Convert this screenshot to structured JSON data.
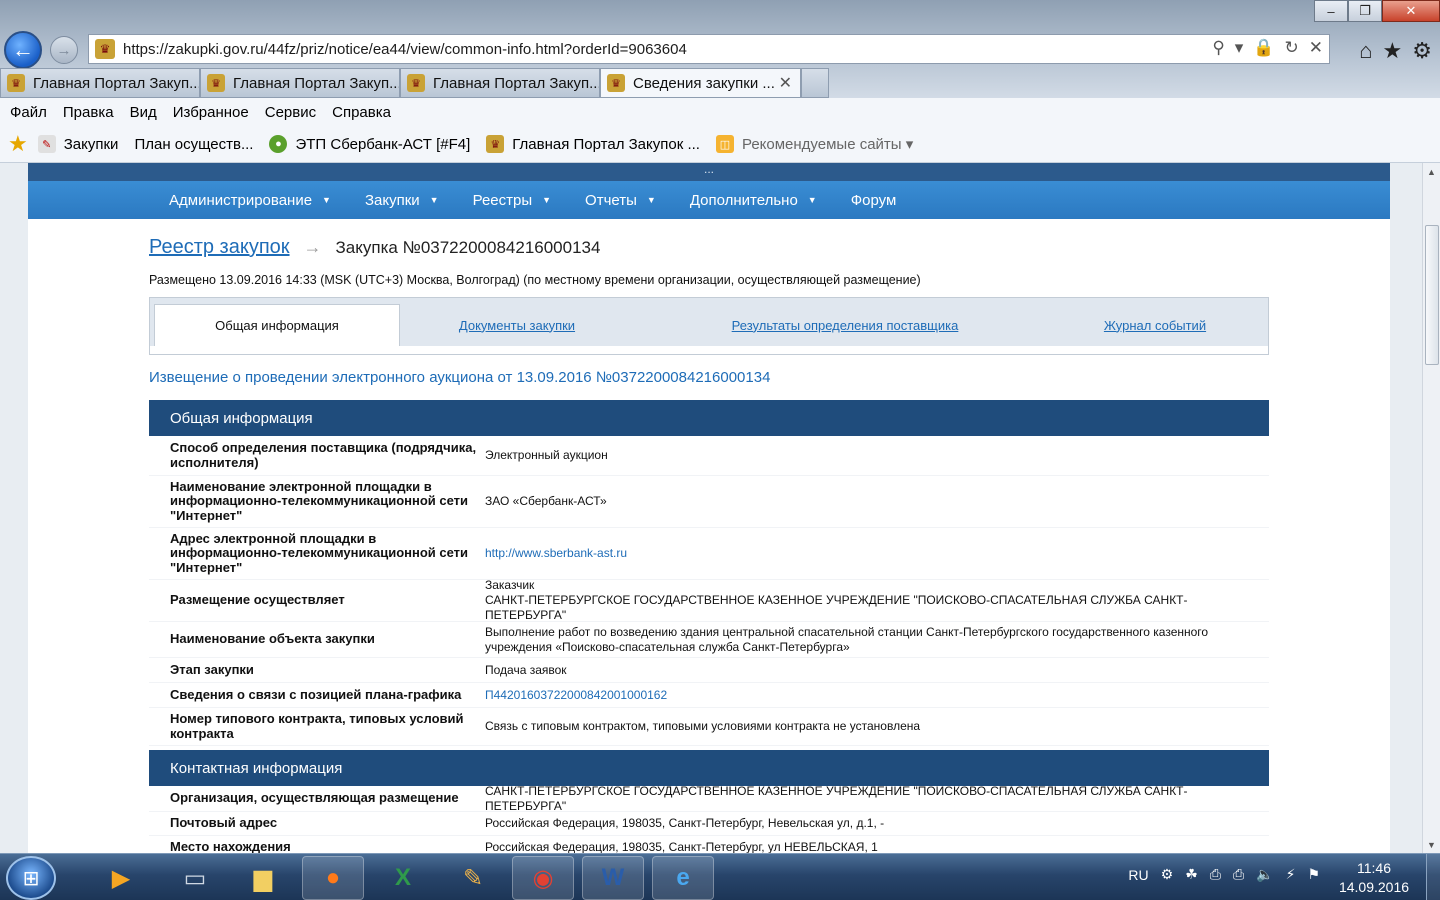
{
  "browser": {
    "url": "https://zakupki.gov.ru/44fz/priz/notice/ea44/view/common-info.html?orderId=9063604",
    "tabs": [
      {
        "label": "Главная Портал Закуп..."
      },
      {
        "label": "Главная Портал Закуп..."
      },
      {
        "label": "Главная Портал Закуп..."
      },
      {
        "label": "Сведения закупки ..."
      }
    ],
    "menu": [
      "Файл",
      "Правка",
      "Вид",
      "Избранное",
      "Сервис",
      "Справка"
    ],
    "favorites": [
      {
        "label": "Закупки"
      },
      {
        "label": "План осуществ..."
      },
      {
        "label": "ЭТП Сбербанк-АСТ [#F4]"
      },
      {
        "label": "Главная Портал Закупок ..."
      },
      {
        "label": "Рекомендуемые сайты ▾"
      }
    ]
  },
  "site": {
    "top_strip": "...",
    "nav": [
      {
        "label": "Администрирование",
        "caret": "▼"
      },
      {
        "label": "Закупки",
        "caret": "▼"
      },
      {
        "label": "Реестры",
        "caret": "▼"
      },
      {
        "label": "Отчеты",
        "caret": "▼"
      },
      {
        "label": "Дополнительно",
        "caret": "▼"
      },
      {
        "label": "Форум",
        "caret": ""
      }
    ],
    "breadcrumb": {
      "parent": "Реестр закупок",
      "arrow": "→",
      "current": "Закупка №0372200084216000134"
    },
    "posted": "Размещено 13.09.2016 14:33 (MSK (UTC+3) Москва, Волгоград) (по местному времени организации, осуществляющей размещение)",
    "tabs": [
      {
        "label": "Общая информация"
      },
      {
        "label": "Документы закупки"
      },
      {
        "label": "Результаты определения поставщика"
      },
      {
        "label": "Журнал событий"
      }
    ],
    "notice_title": "Извещение о проведении электронного аукциона от 13.09.2016 №0372200084216000134",
    "sections": {
      "general": {
        "title": "Общая информация",
        "rows": [
          {
            "label": "Способ определения поставщика (подрядчика, исполнителя)",
            "value": "Электронный аукцион"
          },
          {
            "label": "Наименование электронной площадки в информационно-телекоммуникационной сети \"Интернет\"",
            "value": "ЗАО «Сбербанк-АСТ»"
          },
          {
            "label": "Адрес электронной площадки в информационно-телекоммуникационной сети \"Интернет\"",
            "value": "http://www.sberbank-ast.ru"
          },
          {
            "label": "Размещение осуществляет",
            "value_line1": "Заказчик",
            "value_line2": "САНКТ-ПЕТЕРБУРГСКОЕ ГОСУДАРСТВЕННОЕ КАЗЕННОЕ УЧРЕЖДЕНИЕ \"ПОИСКОВО-СПАСАТЕЛЬНАЯ СЛУЖБА САНКТ-ПЕТЕРБУРГА\""
          },
          {
            "label": "Наименование объекта закупки",
            "value": "Выполнение работ по возведению здания центральной спасательной станции Санкт-Петербургского государственного казенного учреждения «Поисково-спасательная служба Санкт-Петербурга»"
          },
          {
            "label": "Этап закупки",
            "value": "Подача заявок"
          },
          {
            "label": "Сведения о связи с позицией плана-графика",
            "value": "П44201603722000842001000162"
          },
          {
            "label": "Номер типового контракта, типовых условий контракта",
            "value": "Связь с типовым контрактом, типовыми условиями контракта не установлена"
          }
        ]
      },
      "contact": {
        "title": "Контактная информация",
        "rows": [
          {
            "label": "Организация, осуществляющая размещение",
            "value": "САНКТ-ПЕТЕРБУРГСКОЕ ГОСУДАРСТВЕННОЕ КАЗЕННОЕ УЧРЕЖДЕНИЕ \"ПОИСКОВО-СПАСАТЕЛЬНАЯ СЛУЖБА САНКТ-ПЕТЕРБУРГА\""
          },
          {
            "label": "Почтовый адрес",
            "value": "Российская Федерация, 198035, Санкт-Петербург, Невельская ул, д.1, -"
          },
          {
            "label": "Место нахождения",
            "value": "Российская Федерация, 198035, Санкт-Петербург, ул НЕВЕЛЬСКАЯ, 1"
          }
        ]
      }
    }
  },
  "taskbar": {
    "lang": "RU",
    "time": "11:46",
    "date": "14.09.2016"
  },
  "colors": {
    "nav_blue": "#2b79c1",
    "section_header": "#1f4c7c",
    "link": "#1e6cb7"
  }
}
